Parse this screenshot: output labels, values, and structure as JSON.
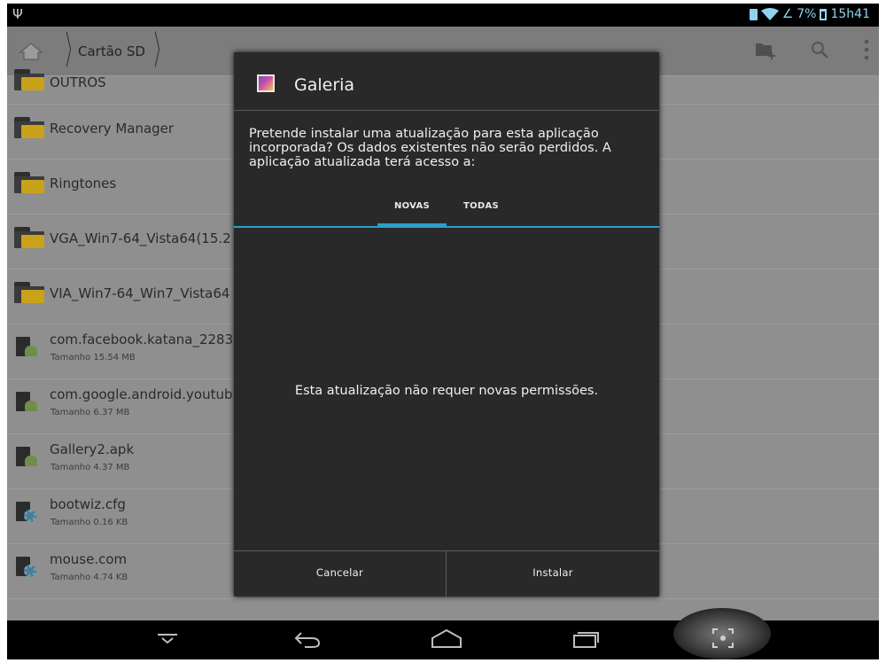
{
  "status_bar": {
    "battery_percent": "7%",
    "time": "15h41",
    "accent_color": "#8fd3ee"
  },
  "action_bar": {
    "breadcrumb": "Cartão SD",
    "icons": [
      "home-icon",
      "new-folder-icon",
      "search-icon",
      "overflow-menu-icon"
    ]
  },
  "files": [
    {
      "name": "OUTROS",
      "size": "",
      "type": "folder"
    },
    {
      "name": "Recovery Manager",
      "size": "",
      "type": "folder"
    },
    {
      "name": "Ringtones",
      "size": "",
      "type": "folder"
    },
    {
      "name": "VGA_Win7-64_Vista64(15.2",
      "size": "",
      "type": "folder"
    },
    {
      "name": "VIA_Win7-64_Win7_Vista64",
      "size": "",
      "type": "folder"
    },
    {
      "name": "com.facebook.katana_2283",
      "size": "Tamanho 15.54 MB",
      "type": "apk"
    },
    {
      "name": "com.google.android.youtub",
      "size": "Tamanho 6.37 MB",
      "type": "apk"
    },
    {
      "name": "Gallery2.apk",
      "size": "Tamanho 4.37 MB",
      "type": "apk"
    },
    {
      "name": "bootwiz.cfg",
      "size": "Tamanho 0.16 KB",
      "type": "file"
    },
    {
      "name": "mouse.com",
      "size": "Tamanho 4.74 KB",
      "type": "file"
    }
  ],
  "dialog": {
    "title": "Galeria",
    "message": "Pretende instalar uma atualização para esta aplicação incorporada? Os dados existentes não serão perdidos. A aplicação atualizada terá acesso a:",
    "tabs": [
      "NOVAS",
      "TODAS"
    ],
    "selected_tab": "NOVAS",
    "body_text": "Esta atualização não requer novas permissões.",
    "cancel_label": "Cancelar",
    "install_label": "Instalar",
    "accent_color": "#2e9ec8"
  },
  "nav_bar": {
    "icons": [
      "hide-keyboard-icon",
      "back-icon",
      "home-icon",
      "recent-apps-icon",
      "screenshot-icon"
    ]
  }
}
